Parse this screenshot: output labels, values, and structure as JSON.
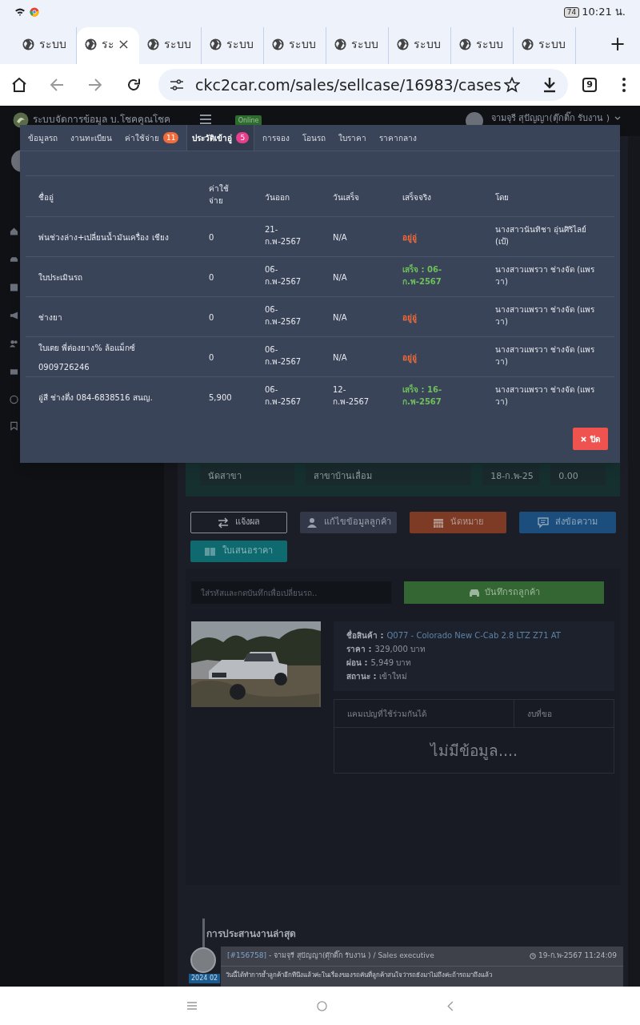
{
  "status_bar": {
    "time": "10:21 น.",
    "battery": "74"
  },
  "browser": {
    "tabs": [
      {
        "title": "ระบบ",
        "selected": false
      },
      {
        "title": "ระ",
        "selected": true
      },
      {
        "title": "ระบบ",
        "selected": false
      },
      {
        "title": "ระบบ",
        "selected": false
      },
      {
        "title": "ระบบ",
        "selected": false
      },
      {
        "title": "ระบบ",
        "selected": false
      },
      {
        "title": "ระบบ",
        "selected": false
      },
      {
        "title": "ระบบ",
        "selected": false
      },
      {
        "title": "ระบบ",
        "selected": false
      }
    ],
    "new_tab": "+",
    "url": "ckc2car.com/sales/sellcase/16983/cases",
    "tab_count": "9",
    "back_disabled": true,
    "forward_disabled": true
  },
  "app_header": {
    "title": "ระบบจัดการข้อมูล บ.โชคคูณโชค",
    "online": "Online",
    "user": "จามจุรี สุปัญญา(ตุ๊กติ๊ก รับงาน )"
  },
  "modal": {
    "tabs": [
      {
        "label": "ข้อมูลรถ",
        "selected": false
      },
      {
        "label": "งานทะเบียน",
        "selected": false
      },
      {
        "label": "ค่าใช้จ่าย",
        "selected": false,
        "badge": {
          "text": "11",
          "color": "#f26b3a"
        }
      },
      {
        "label": "ประวัติเข้าอู่",
        "selected": true,
        "badge": {
          "text": "5",
          "color": "#e83e8c"
        }
      },
      {
        "label": "การจอง",
        "selected": false
      },
      {
        "label": "โอนรถ",
        "selected": false
      },
      {
        "label": "ใบราคา",
        "selected": false
      },
      {
        "label": "ราคากลาง",
        "selected": false
      }
    ],
    "columns": [
      "ชื่ออู่",
      "ค่าใช้จ่าย",
      "วันออก",
      "วันเสร็จ",
      "เสร็จจริง",
      "โดย"
    ],
    "rows": [
      {
        "garage": "พ่นช่วงล่าง+เปลี่ยนน้ำมันเครื่อง เชียง",
        "cost": "0",
        "out_date": "21-ก.พ-2567",
        "done_date": "N/A",
        "actual": "อยู่อู่",
        "kind": "in_shop",
        "by": "นางสาวนันทิชา อุ่นศิริไลย์ (เป้)"
      },
      {
        "garage": "ใบประเมินรถ",
        "cost": "0",
        "out_date": "06-ก.พ-2567",
        "done_date": "N/A",
        "actual": "เสร็จ : 06-ก.พ-2567",
        "kind": "done",
        "by": "นางสาวแพรวา ช่างจัด (แพรวา)"
      },
      {
        "garage": "ช่างยา",
        "cost": "0",
        "out_date": "06-ก.พ-2567",
        "done_date": "N/A",
        "actual": "อยู่อู่",
        "kind": "in_shop",
        "by": "นางสาวแพรวา ช่างจัด (แพรวา)"
      },
      {
        "garage": "ใบเตย พี่ต่องยาง% ล้อแม็กซ์ 0909726246",
        "cost": "0",
        "out_date": "06-ก.พ-2567",
        "done_date": "N/A",
        "actual": "อยู่อู่",
        "kind": "in_shop",
        "by": "นางสาวแพรวา ช่างจัด (แพรวา)"
      },
      {
        "garage": "อู่สี ช่างตึ่ง 084-6838516 สนญ.",
        "cost": "5,900",
        "out_date": "06-ก.พ-2567",
        "done_date": "12-ก.พ-2567",
        "actual": "เสร็จ : 16-ก.พ-2567",
        "kind": "done",
        "by": "นางสาวแพรวา ช่างจัด (แพรวา)"
      }
    ],
    "close": "ปิด"
  },
  "branch_row": [
    "นัดสาขา",
    "สาขาบ้านเลื่อม",
    "18-ก.พ-25",
    "0.00"
  ],
  "actions": [
    {
      "label": "แจ้งผล",
      "kind": "outline"
    },
    {
      "label": "แก้ไขข้อมูลลูกค้า",
      "kind": "gray"
    },
    {
      "label": "นัดหมาย",
      "kind": "orange"
    },
    {
      "label": "ส่งข้อความ",
      "kind": "blue"
    },
    {
      "label": "ใบเสนอราคา",
      "kind": "teal"
    }
  ],
  "change_car": {
    "placeholder": "ใส่รหัสและกดบันทึกเพื่อเปลี่ยนรถ..",
    "button": "บันทึกรถลูกค้า"
  },
  "product": {
    "fields": [
      {
        "label": "ชื่อสินค้า :",
        "value": "Q077 - Colorado New C-Cab 2.8 LTZ Z71 AT",
        "kind": "link"
      },
      {
        "label": "ราคา :",
        "value": "329,000 บาท",
        "kind": "text"
      },
      {
        "label": "ผ่อน :",
        "value": "5,949 บาท",
        "kind": "text"
      },
      {
        "label": "สถานะ :",
        "value": "เข้าใหม่",
        "kind": "text"
      }
    ]
  },
  "campaigns": {
    "columns": [
      "แคมเปญที่ใช้ร่วมกันได้",
      "งบที่ขอ"
    ],
    "empty": "ไม่มีข้อมูล...."
  },
  "timeline": {
    "title": "การประสานงานล่าสุด",
    "entries": [
      {
        "date_badge": "2024 02",
        "ref": "[#156758]",
        "author": "- จามจุรี สุปัญญา(ตุ๊กติ๊ก รับงาน ) / Sales executive",
        "time": "19-ก.พ-2567 11:24:09",
        "text": "วันนี้ได้ทำการย้ำลูกค้าอีกทีนึงแล้วค่ะในเรื่องของรถคันที่ลูกค้าสนใจว่ารถยังมาไม่ถึงค่ะถ้ารถมาถึงแล้ว"
      }
    ]
  }
}
